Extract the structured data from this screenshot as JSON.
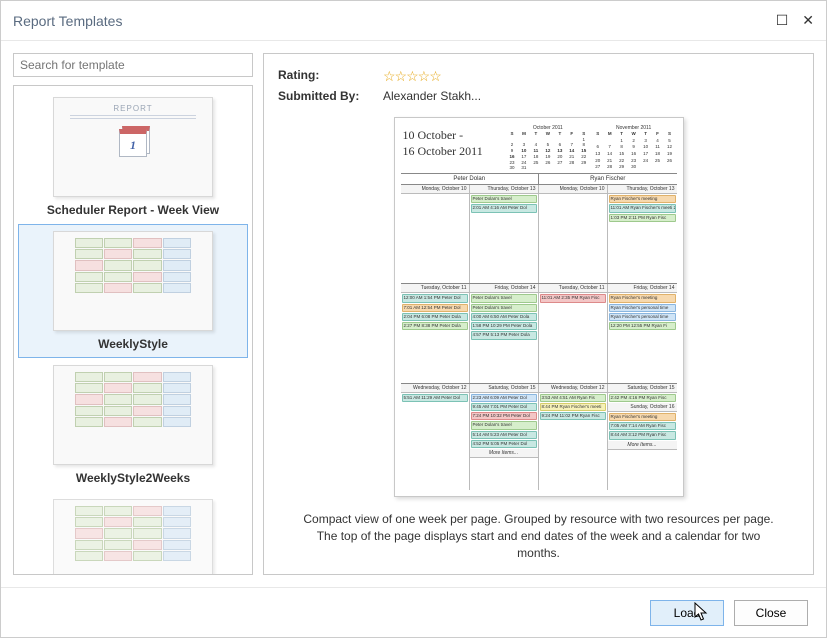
{
  "window": {
    "title": "Report Templates",
    "maximize_glyph": "☐",
    "close_glyph": "✕"
  },
  "search": {
    "placeholder": "Search for template"
  },
  "templates": [
    {
      "label": "Scheduler Report - Week View",
      "thumb_tag": "REPORT",
      "selected": false
    },
    {
      "label": "WeeklyStyle",
      "selected": true
    },
    {
      "label": "WeeklyStyle2Weeks",
      "selected": false
    }
  ],
  "details": {
    "rating_label": "Rating:",
    "rating_stars": "☆☆☆☆☆",
    "submitted_label": "Submitted By:",
    "submitted_value": "Alexander Stakh...",
    "description": "Compact view of one week per page. Grouped by resource with two resources per page. The top of the page displays start and end dates of the week and a calendar for two months."
  },
  "preview": {
    "date_range_line1": "10 October -",
    "date_range_line2": "16 October 2011",
    "cal1_title": "October 2011",
    "cal2_title": "November 2011",
    "dow": [
      "S",
      "M",
      "T",
      "W",
      "T",
      "F",
      "S"
    ],
    "resources": [
      "Peter Dolan",
      "Ryan Fischer"
    ],
    "days_r1": [
      "Monday, October 10",
      "Thursday, October 13"
    ],
    "days_r2": [
      "Monday, October 10",
      "Thursday, October 13"
    ],
    "days_mid_r1": [
      "Tuesday, October 11",
      "Friday, October 14"
    ],
    "days_mid_r2": [
      "Tuesday, October 11",
      "Friday, October 14"
    ],
    "days_bot_r1": [
      "Wednesday, October 12",
      "Saturday, October 15"
    ],
    "days_bot_r2": [
      "Wednesday, October 12",
      "Saturday, October 15"
    ],
    "sunday": "Sunday, October 16",
    "events": {
      "r1_thu": [
        {
          "c": "c-green",
          "t": "Peter Dolan's travel"
        },
        {
          "c": "c-teal",
          "t": "2:01 AM  4:16 AM  Peter Dol"
        }
      ],
      "r2_thu_a": [
        {
          "c": "c-orange",
          "t": "Ryan Fischer's meeting"
        },
        {
          "c": "c-teal",
          "t": "11:01 AM Ryan Fischer's meeti 2:18 AM"
        },
        {
          "c": "c-green",
          "t": "1:03 PM  2:11 PM  Ryan Fisc"
        }
      ],
      "r1_tue": [
        {
          "c": "c-teal",
          "t": "12:00 AM  1:54 PM  Peter Dol"
        },
        {
          "c": "c-orange",
          "t": "7:01 AM  12:54 PM  Peter Dol"
        },
        {
          "c": "c-teal",
          "t": "2:04 PM  6:08 PM  Peter Dola"
        },
        {
          "c": "c-green",
          "t": "2:27 PM  8:38 PM  Peter Dola"
        }
      ],
      "r1_fri": [
        {
          "c": "c-green",
          "t": "Peter Dolan's travel"
        },
        {
          "c": "c-green",
          "t": "Peter Dolan's travel"
        },
        {
          "c": "c-teal",
          "t": "4:00 AM  6:50 AM  Peter Dola"
        },
        {
          "c": "c-teal",
          "t": "1:58 PM  10:29 PM  Peter Dola"
        },
        {
          "c": "c-teal",
          "t": "4:57 PM  5:13 PM  Peter Dola"
        }
      ],
      "r2_tue": [
        {
          "c": "c-red",
          "t": "11:01 AM  2:35 PM  Ryan Fisc"
        }
      ],
      "r2_fri": [
        {
          "c": "c-orange",
          "t": "Ryan Fischer's meeting"
        },
        {
          "c": "c-blue",
          "t": "Ryan Fischer's personal time"
        },
        {
          "c": "c-blue",
          "t": "Ryan Fischer's personal time"
        },
        {
          "c": "c-green",
          "t": "12:20 PM  12:55 PM  Ryan Fi"
        }
      ],
      "r1_wed": [
        {
          "c": "c-teal",
          "t": "5:51 AM  11:29 AM  Peter Dol"
        }
      ],
      "r1_sat": [
        {
          "c": "c-blue",
          "t": "2:23 AM  6:09 AM  Peter Dol"
        },
        {
          "c": "c-teal",
          "t": "9:45 AM  7:01 PM  Peter Dol"
        },
        {
          "c": "c-red",
          "t": "7:24 PM  10:32 PM  Peter Dol"
        },
        {
          "c": "c-green",
          "t": "Peter Dolan's travel"
        },
        {
          "c": "c-teal",
          "t": "5:14 AM  5:23 AM  Peter Dol"
        },
        {
          "c": "c-teal",
          "t": "4:52 PM  5:05 PM  Peter Dol"
        }
      ],
      "r2_wed": [
        {
          "c": "c-green",
          "t": "3:53 AM  4:51 AM  Ryan Fis"
        },
        {
          "c": "c-yellow",
          "t": "8:44 PM Ryan Fischer's meeti"
        },
        {
          "c": "c-teal",
          "t": "9:24 PM  11:02 PM  Ryan Fisc"
        }
      ],
      "r2_sat": [
        {
          "c": "c-green",
          "t": "2:42 PM  4:16 PM  Ryan Fisc"
        }
      ],
      "r2_sun": [
        {
          "c": "c-orange",
          "t": "Ryan Fischer's meeting"
        },
        {
          "c": "c-teal",
          "t": "7:05 AM  7:14 AM  Ryan Fisc"
        },
        {
          "c": "c-teal",
          "t": "8:44 AM  3:12 PM  Ryan Fisc"
        }
      ]
    },
    "more_items": "More Items..."
  },
  "buttons": {
    "load": "Load",
    "close": "Close"
  }
}
